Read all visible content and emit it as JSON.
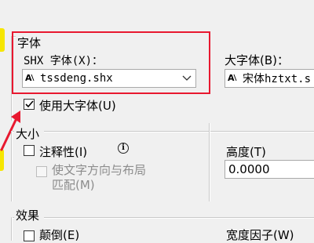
{
  "font_group": {
    "title": "字体",
    "shx_label": "SHX 字体(X)：",
    "shx_value": "tssdeng.shx",
    "bigfont_label": "大字体(B)：",
    "bigfont_value": "宋体hztxt.s",
    "use_bigfont_label": "使用大字体(U)",
    "use_bigfont_checked": true
  },
  "size_group": {
    "title": "大小",
    "annotative_label": "注释性(I)",
    "annotative_checked": false,
    "match_orientation_line1": "使文字方向与布局",
    "match_orientation_line2": "匹配(M)",
    "height_label": "高度(T)",
    "height_value": "0.0000"
  },
  "effects_group": {
    "title": "效果",
    "upside_down_label": "颠倒(E)",
    "width_factor_label": "宽度因子(W)"
  },
  "icons": {
    "shx_icon": "shx-font-icon",
    "chevron": "chevron-down-icon",
    "info": "info-icon",
    "check": "checkmark-icon"
  },
  "colors": {
    "highlight_box": "#e8182f",
    "annotation_arrow": "#e8182f",
    "highlighter": "#f6e600"
  }
}
